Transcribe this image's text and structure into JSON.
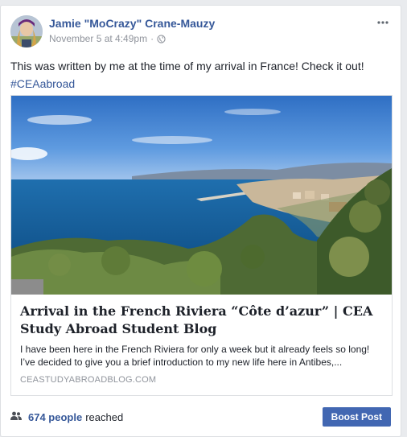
{
  "post": {
    "author": "Jamie \"MoCrazy\" Crane-Mauzy",
    "timestamp": "November 5 at 4:49pm",
    "separator": "·",
    "privacy_icon": "globe-icon",
    "more_icon": "more-horizontal-icon",
    "text": "This was written by me at the time of my arrival in France! Check it out!",
    "hashtag": "#CEAabroad"
  },
  "link_preview": {
    "image_icon": "coastline-photo",
    "title": "Arrival in the French Riviera “Côte d’azur” | CEA Study Abroad Student Blog",
    "description": "I have been here in the French Riviera for only a week but it already feels so long! I’ve decided to give you a brief introduction to my new life here in Antibes,...",
    "domain": "CEASTUDYABROADBLOG.COM"
  },
  "footer": {
    "reach_icon": "people-icon",
    "reach_count": "674 people",
    "reach_label": "reached",
    "boost_label": "Boost Post"
  },
  "colors": {
    "link_blue": "#365899",
    "boost_blue": "#4267b2",
    "meta_gray": "#90949c"
  }
}
